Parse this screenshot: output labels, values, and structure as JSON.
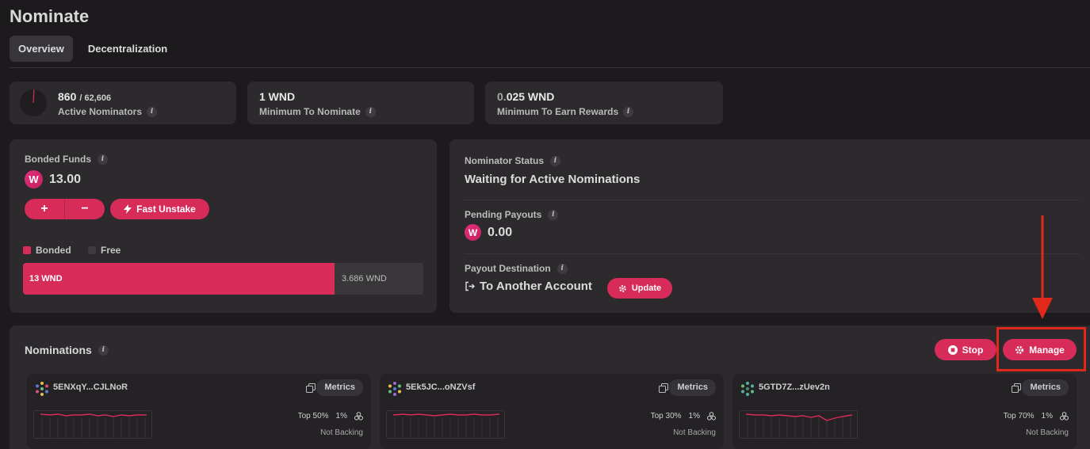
{
  "page": {
    "title": "Nominate"
  },
  "tabs": [
    {
      "label": "Overview",
      "active": true
    },
    {
      "label": "Decentralization",
      "active": false
    }
  ],
  "stats": {
    "active_nominators": {
      "value": "860",
      "total": "/ 62,606",
      "label": "Active Nominators",
      "fraction": 0.0137
    },
    "min_nominate": {
      "value": "1 WND",
      "label": "Minimum To Nominate"
    },
    "min_rewards": {
      "value_prefix": "0.",
      "value_main": "025 WND",
      "label": "Minimum To Earn Rewards"
    }
  },
  "bonded": {
    "label": "Bonded Funds",
    "token_letter": "W",
    "amount": "13.00",
    "add_label": "+",
    "remove_label": "−",
    "fast_unstake_label": "Fast Unstake",
    "legend_bonded": "Bonded",
    "legend_free": "Free",
    "bar_bonded_text": "13 WND",
    "bar_free_text": "3.686 WND",
    "bonded_value": 13,
    "free_value": 3.686
  },
  "status": {
    "nominator_status_label": "Nominator Status",
    "nominator_status_value": "Waiting for Active Nominations",
    "pending_payouts_label": "Pending Payouts",
    "pending_payouts_value": "0.00",
    "payout_destination_label": "Payout Destination",
    "payout_destination_value": "To Another Account",
    "update_label": "Update"
  },
  "nominations": {
    "title": "Nominations",
    "stop_label": "Stop",
    "manage_label": "Manage",
    "items": [
      {
        "address": "5ENXqY...CJLNoR",
        "metrics_label": "Metrics",
        "rank": "Top 50%",
        "commission": "1%",
        "backing": "Not Backing"
      },
      {
        "address": "5Ek5JC...oNZVsf",
        "metrics_label": "Metrics",
        "rank": "Top 30%",
        "commission": "1%",
        "backing": "Not Backing"
      },
      {
        "address": "5GTD7Z...zUev2n",
        "metrics_label": "Metrics",
        "rank": "Top 70%",
        "commission": "1%",
        "backing": "Not Backing"
      }
    ]
  },
  "colors": {
    "accent": "#d72b5a",
    "highlight": "#e0291a",
    "background": "#1c1a1c",
    "card": "#2d2a2e"
  },
  "icons": [
    "info-icon",
    "bolt-icon",
    "gear-icon",
    "stop-icon",
    "copy-icon",
    "logout-icon",
    "identicon"
  ]
}
